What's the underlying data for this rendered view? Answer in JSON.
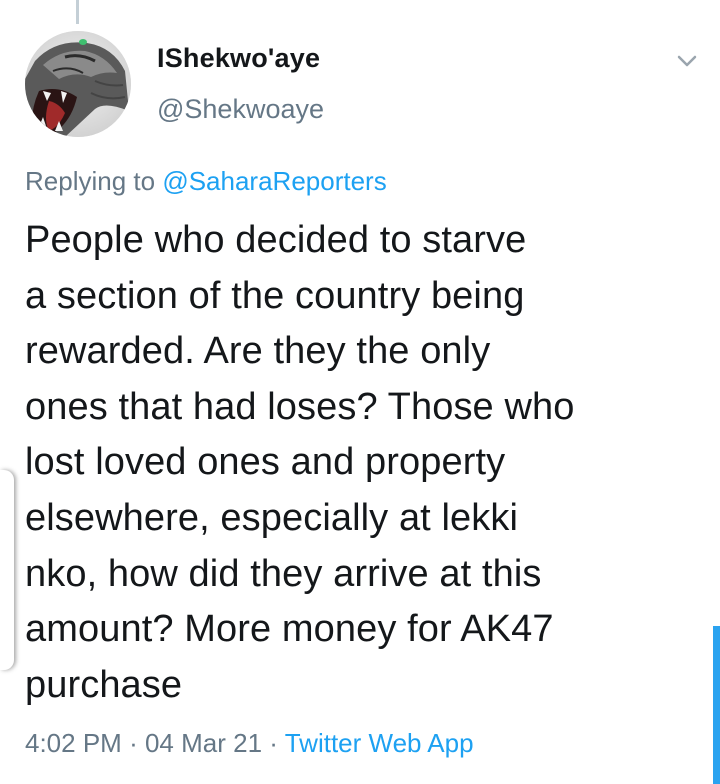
{
  "tweet": {
    "display_name": "IShekwo'aye",
    "handle": "@Shekwoaye",
    "replying_label": "Replying to",
    "replying_to": "@SaharaReporters",
    "text": "People who decided to starve\na section of the country being\nrewarded. Are they the only\nones that had loses? Those who\nlost loved ones and property\nelsewhere, especially at lekki\nnko, how did they arrive at this\namount? More money for AK47\npurchase",
    "time": "4:02 PM",
    "separator": "·",
    "date": "04 Mar 21",
    "source": "Twitter Web App"
  },
  "icons": {
    "avatar": "snarling-cat-avatar",
    "menu": "chevron-down-icon"
  },
  "colors": {
    "link": "#1da1f2",
    "secondary_text": "#657786",
    "primary_text": "#14171a",
    "scrollbar": "#2aa3f0"
  }
}
